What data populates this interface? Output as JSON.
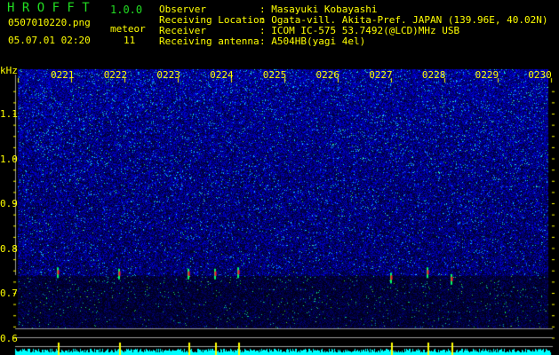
{
  "header": {
    "app_name": "H R O F F T",
    "version": "1.0.0",
    "filename": "0507010220.png",
    "datetime": "05.07.01 02:20",
    "meteor_label": "meteor",
    "meteor_count": "11"
  },
  "info": {
    "observer_label": "Observer",
    "observer": ": Masayuki Kobayashi",
    "location_label": "Receiving Location",
    "location": ": Ogata-vill. Akita-Pref. JAPAN (139.96E, 40.02N)",
    "receiver_label": "Receiver",
    "receiver": ": ICOM IC-575 53.7492(@LCD)MHz USB",
    "antenna_label": "Receiving antenna",
    "antenna": ": A504HB(yagi 4el)"
  },
  "spectrogram": {
    "y_unit": "kHz",
    "y_ticks": [
      "1.1",
      "1.0",
      "0.9",
      "0.8",
      "0.7",
      "0.6"
    ],
    "time_ticks": [
      "0221",
      "0222",
      "0223",
      "0224",
      "0225",
      "0226",
      "0227",
      "0228",
      "0229",
      "0230"
    ],
    "colors": {
      "text": "#ffff00",
      "noise": "#1030e0",
      "histogram": "#00ffff",
      "echo_bar": "#ffff00",
      "gridline": "#9a9a9a"
    },
    "echoes": [
      {
        "time": "02:20:45",
        "freq_khz": 0.745
      },
      {
        "time": "02:21:54",
        "freq_khz": 0.742
      },
      {
        "time": "02:23:12",
        "freq_khz": 0.742
      },
      {
        "time": "02:23:42",
        "freq_khz": 0.742
      },
      {
        "time": "02:24:08",
        "freq_khz": 0.745
      },
      {
        "time": "02:27:00",
        "freq_khz": 0.733
      },
      {
        "time": "02:27:41",
        "freq_khz": 0.745
      },
      {
        "time": "02:28:08",
        "freq_khz": 0.73
      }
    ]
  }
}
